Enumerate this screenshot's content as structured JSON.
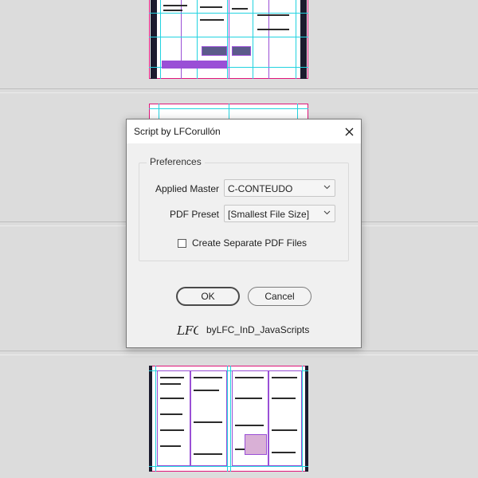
{
  "dialog": {
    "title": "Script by LFCorullón",
    "group_label": "Preferences",
    "applied_master_label": "Applied Master",
    "applied_master_value": "C-CONTEUDO",
    "pdf_preset_label": "PDF Preset",
    "pdf_preset_value": "[Smallest File Size]",
    "separate_pdf_label": "Create Separate PDF Files",
    "separate_pdf_checked": false,
    "ok_label": "OK",
    "cancel_label": "Cancel",
    "logo_text": "LFC",
    "credit": "byLFC_InD_JavaScripts"
  },
  "icons": {
    "close": "close-icon",
    "dropdown": "chevron-down-icon",
    "logo": "lfc-logo-icon"
  },
  "colors": {
    "pasteboard": "#dcdcdc",
    "dialog_bg": "#f0f0f0",
    "titlebar_bg": "#ffffff",
    "guide_cyan": "#22d3e0",
    "guide_magenta": "#e0157a",
    "column_purple": "#9a4fd6"
  }
}
